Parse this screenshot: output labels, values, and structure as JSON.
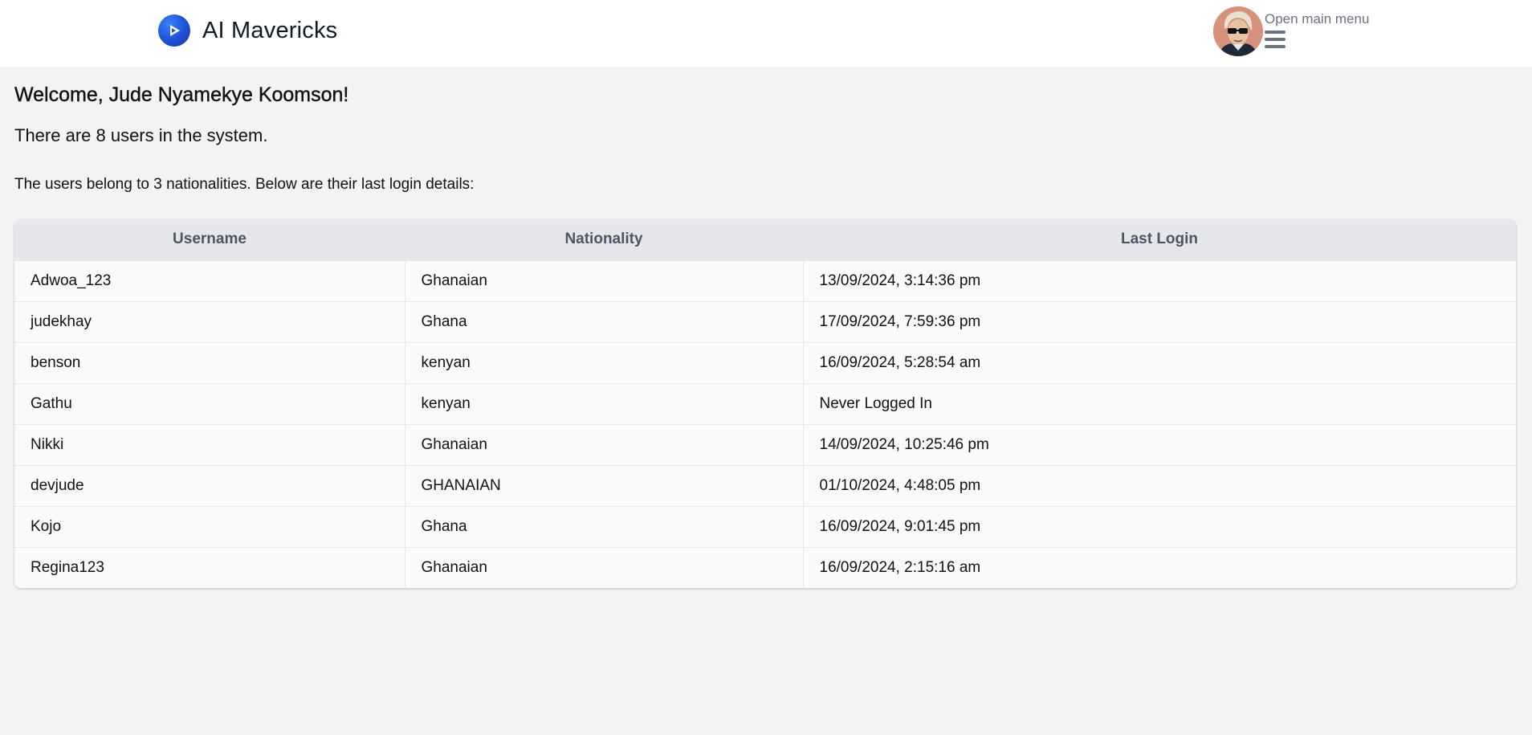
{
  "header": {
    "brand_name": "AI Mavericks",
    "menu_label": "Open main menu",
    "logo_icon": "play-circle-icon",
    "avatar_icon": "user-avatar"
  },
  "main": {
    "welcome": "Welcome, Jude Nyamekye Koomson!",
    "user_count_text": "There are 8 users in the system.",
    "nationality_text": "The users belong to 3 nationalities. Below are their last login details:"
  },
  "table": {
    "columns": [
      "Username",
      "Nationality",
      "Last Login"
    ],
    "rows": [
      {
        "username": "Adwoa_123",
        "nationality": "Ghanaian",
        "last_login": "13/09/2024, 3:14:36 pm"
      },
      {
        "username": "judekhay",
        "nationality": "Ghana",
        "last_login": "17/09/2024, 7:59:36 pm"
      },
      {
        "username": "benson",
        "nationality": "kenyan",
        "last_login": "16/09/2024, 5:28:54 am"
      },
      {
        "username": "Gathu",
        "nationality": "kenyan",
        "last_login": "Never Logged In"
      },
      {
        "username": "Nikki",
        "nationality": "Ghanaian",
        "last_login": "14/09/2024, 10:25:46 pm"
      },
      {
        "username": "devjude",
        "nationality": "GHANAIAN",
        "last_login": "01/10/2024, 4:48:05 pm"
      },
      {
        "username": "Kojo",
        "nationality": "Ghana",
        "last_login": "16/09/2024, 9:01:45 pm"
      },
      {
        "username": "Regina123",
        "nationality": "Ghanaian",
        "last_login": "16/09/2024, 2:15:16 am"
      }
    ]
  },
  "colors": {
    "page_bg": "#f2f3f5",
    "header_bg": "#ffffff",
    "brand_blue": "#1d4ed8",
    "table_header_bg": "#e5e7eb",
    "muted_text": "#6b7280"
  }
}
